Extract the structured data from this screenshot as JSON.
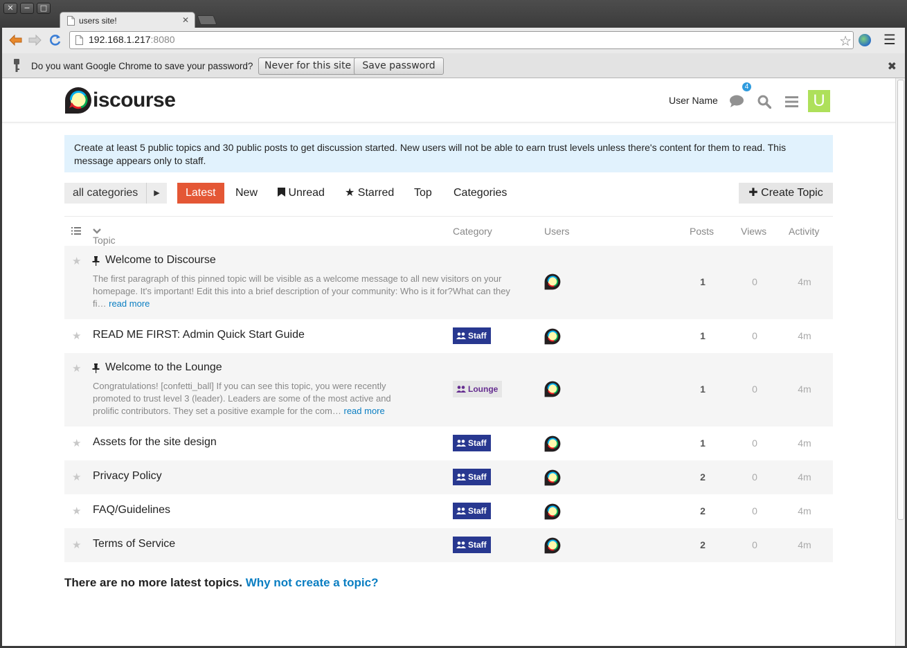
{
  "window": {
    "close_glyph": "✕",
    "minimize_glyph": "−",
    "maximize_glyph": "□"
  },
  "browser": {
    "tab_title": "users site!",
    "url_host": "192.168.1.217",
    "url_port": ":8080",
    "infobar": {
      "question": "Do you want Google Chrome to save your password?",
      "never_label": "Never for this site",
      "save_label": "Save password",
      "close_glyph": "✖"
    }
  },
  "header": {
    "logo_text": "iscourse",
    "user_name": "User Name",
    "notification_count": "4",
    "avatar_letter": "U"
  },
  "banner": {
    "text": "Create at least 5 public topics and 30 public posts to get discussion started. New users will not be able to earn trust levels unless there's content for them to read. This message appears only to staff."
  },
  "nav": {
    "category_dropdown": "all categories",
    "items": [
      "Latest",
      "New",
      "Unread",
      "Starred",
      "Top",
      "Categories"
    ],
    "create_topic": "Create Topic"
  },
  "columns": {
    "topic": "Topic",
    "category": "Category",
    "users": "Users",
    "posts": "Posts",
    "views": "Views",
    "activity": "Activity"
  },
  "topics": [
    {
      "title": "Welcome to Discourse",
      "pinned": true,
      "excerpt_lines": [
        "The first paragraph of this pinned topic will be visible as a welcome message to all new visitors on your",
        "homepage. It's important! Edit this into a brief description of your community: Who is it for?What can they",
        "fi… "
      ],
      "read_more": "read more",
      "category": "",
      "posts": "1",
      "views": "0",
      "activity": "4m"
    },
    {
      "title": "READ ME FIRST: Admin Quick Start Guide",
      "pinned": false,
      "category": "Staff",
      "posts": "1",
      "views": "0",
      "activity": "4m"
    },
    {
      "title": "Welcome to the Lounge",
      "pinned": true,
      "excerpt_lines": [
        "Congratulations! [confetti_ball] If you can see this topic, you were recently",
        "promoted to trust level 3 (leader). Leaders are some of the most active and",
        "prolific contributors. They set a positive example for the com… "
      ],
      "read_more": "read more",
      "category": "Lounge",
      "posts": "1",
      "views": "0",
      "activity": "4m"
    },
    {
      "title": "Assets for the site design",
      "pinned": false,
      "category": "Staff",
      "posts": "1",
      "views": "0",
      "activity": "4m"
    },
    {
      "title": "Privacy Policy",
      "pinned": false,
      "category": "Staff",
      "posts": "2",
      "views": "0",
      "activity": "4m"
    },
    {
      "title": "FAQ/Guidelines",
      "pinned": false,
      "category": "Staff",
      "posts": "2",
      "views": "0",
      "activity": "4m"
    },
    {
      "title": "Terms of Service",
      "pinned": false,
      "category": "Staff",
      "posts": "2",
      "views": "0",
      "activity": "4m"
    }
  ],
  "footer": {
    "message": "There are no more latest topics.",
    "link": "Why not create a topic?"
  },
  "colors": {
    "accent": "#e45735",
    "link": "#0a7ec2",
    "staff_badge": "#283890",
    "lounge_text": "#652d90",
    "banner_bg": "#e1f2fd",
    "avatar_bg": "#aee05a",
    "badge_blue": "#2f9bde"
  }
}
